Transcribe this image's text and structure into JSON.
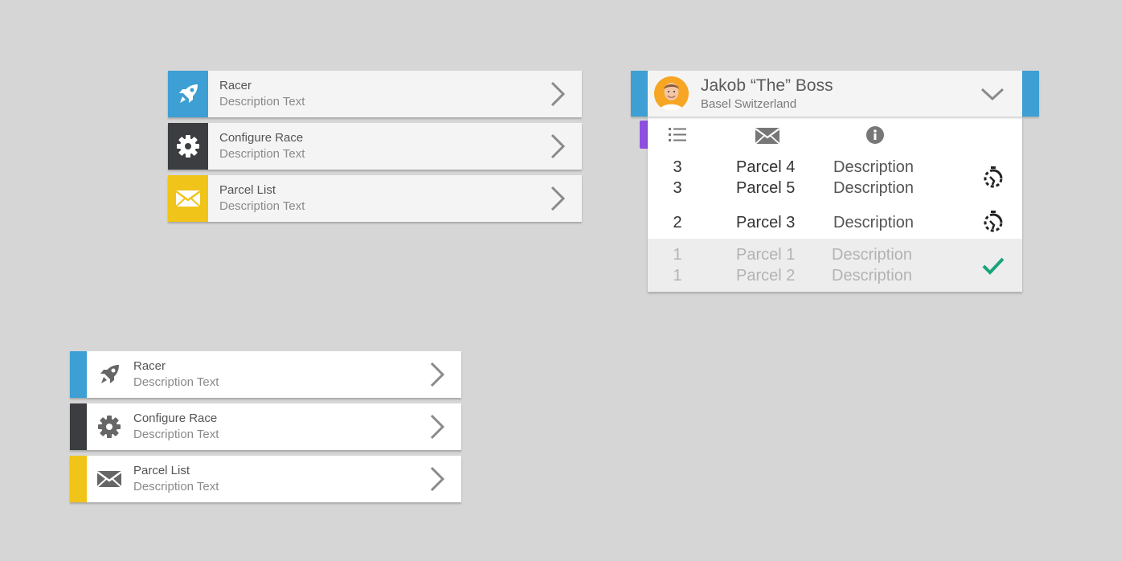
{
  "menu_a": [
    {
      "title": "Racer",
      "desc": "Description Text",
      "icon": "rocket-icon",
      "color": "#3d9fd3"
    },
    {
      "title": "Configure Race",
      "desc": "Description Text",
      "icon": "gear-icon",
      "color": "#3b3d40"
    },
    {
      "title": "Parcel List",
      "desc": "Description Text",
      "icon": "envelope-icon",
      "color": "#f0c419"
    }
  ],
  "menu_b": [
    {
      "title": "Racer",
      "desc": "Description Text",
      "icon": "rocket-icon",
      "color": "#3d9fd3"
    },
    {
      "title": "Configure Race",
      "desc": "Description Text",
      "icon": "gear-icon",
      "color": "#3b3d40"
    },
    {
      "title": "Parcel List",
      "desc": "Description Text",
      "icon": "envelope-icon",
      "color": "#f0c419"
    }
  ],
  "profile": {
    "name": "Jakob “The” Boss",
    "location": "Basel Switzerland",
    "accent": "#3d9fd3",
    "tab_accent": "#8e4fe0",
    "columns": [
      "list-icon",
      "envelope-icon",
      "info-icon"
    ],
    "groups": [
      {
        "status": "in-progress-icon",
        "rows": [
          {
            "num": "3",
            "parcel": "Parcel 4",
            "desc": "Description"
          },
          {
            "num": "3",
            "parcel": "Parcel 5",
            "desc": "Description"
          }
        ]
      },
      {
        "status": "in-progress-icon",
        "rows": [
          {
            "num": "2",
            "parcel": "Parcel 3",
            "desc": "Description"
          }
        ]
      },
      {
        "status": "check-icon",
        "status_color": "#1aa37a",
        "rows": [
          {
            "num": "1",
            "parcel": "Parcel 1",
            "desc": "Description"
          },
          {
            "num": "1",
            "parcel": "Parcel 2",
            "desc": "Description"
          }
        ]
      }
    ]
  }
}
